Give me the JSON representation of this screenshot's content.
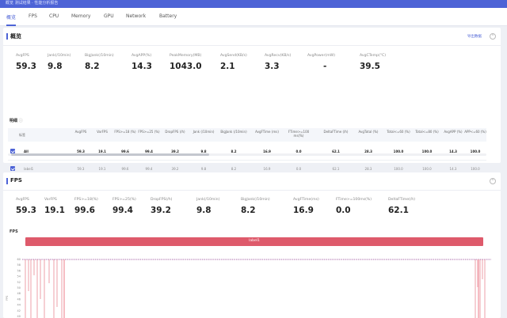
{
  "window": {
    "title": "概览  测试结果 · 性能分析报告"
  },
  "tabs": [
    {
      "label": "概览",
      "active": true
    },
    {
      "label": "FPS"
    },
    {
      "label": "CPU"
    },
    {
      "label": "Memory"
    },
    {
      "label": "GPU"
    },
    {
      "label": "Network"
    },
    {
      "label": "Battery"
    }
  ],
  "overview": {
    "title": "概览",
    "export_label": "导出数据",
    "collapse_icon": "chevron-up-icon",
    "metrics": [
      {
        "label": "AvgFPS",
        "value": "59.3"
      },
      {
        "label": "Jank(/10min)",
        "value": "9.8"
      },
      {
        "label": "BigJank(/10min)",
        "value": "8.2"
      },
      {
        "label": "AvgAPP(%)",
        "value": "14.3"
      },
      {
        "label": "PeakMemory(MB)",
        "value": "1043.0"
      },
      {
        "label": "AvgSend(KB/s)",
        "value": "2.1"
      },
      {
        "label": "AvgRecv(KB/s)",
        "value": "3.3"
      },
      {
        "label": "AvgPower(mW)",
        "value": "-"
      },
      {
        "label": "AvgCTemp(°C)",
        "value": "39.5"
      }
    ],
    "details_label": "明细",
    "table": {
      "headers": [
        "标签",
        "AvgFPS",
        "VarFPS",
        "FPS>=18 (%)",
        "FPS>=25 (%)",
        "DropFPS (/h)",
        "Jank (/10min)",
        "BigJank (/10min)",
        "AvgFTime (ms)",
        "FTime>=100 ms(%)",
        "DeltaFTime (/h)",
        "AvgTotal (%)",
        "Total<=60 (%)",
        "Total<=80 (%)",
        "AvgAPP (%)",
        "APP<=60 (%)"
      ],
      "rows": [
        {
          "cells": [
            "All",
            "59.3",
            "19.1",
            "99.6",
            "99.4",
            "39.2",
            "9.8",
            "8.2",
            "16.9",
            "0.0",
            "62.1",
            "28.3",
            "100.0",
            "100.0",
            "14.3",
            "100.0"
          ]
        },
        {
          "cells": [
            "label1",
            "59.3",
            "19.1",
            "99.6",
            "99.4",
            "39.2",
            "9.8",
            "8.2",
            "16.9",
            "0.0",
            "62.1",
            "28.3",
            "100.0",
            "100.0",
            "14.3",
            "100.0"
          ]
        }
      ]
    }
  },
  "fps": {
    "title": "FPS",
    "collapse_icon": "chevron-up-icon",
    "metrics": [
      {
        "label": "AvgFPS",
        "value": "59.3"
      },
      {
        "label": "VarFPS",
        "value": "19.1"
      },
      {
        "label": "FPS>=18(%)",
        "value": "99.6"
      },
      {
        "label": "FPS>=25(%)",
        "value": "99.4"
      },
      {
        "label": "DropFPS(/h)",
        "value": "39.2"
      },
      {
        "label": "Jank(/10min)",
        "value": "9.8"
      },
      {
        "label": "BigJank(/10min)",
        "value": "8.2"
      },
      {
        "label": "AvgFTime(ms)",
        "value": "16.9"
      },
      {
        "label": "FTime>=100ms(%)",
        "value": "0.0"
      },
      {
        "label": "DeltaFTime(/h)",
        "value": "62.1"
      }
    ],
    "chart": {
      "title": "FPS",
      "label": "label1",
      "ylabel": "FPS",
      "y_ticks": [
        "60",
        "58",
        "56",
        "54",
        "52",
        "50",
        "48",
        "46",
        "44",
        "42",
        "40"
      ]
    }
  },
  "colors": {
    "accent": "#4d63d6",
    "label_bar": "#de5a6b",
    "series_line": "#a04a9a",
    "jank": "#e06070"
  }
}
